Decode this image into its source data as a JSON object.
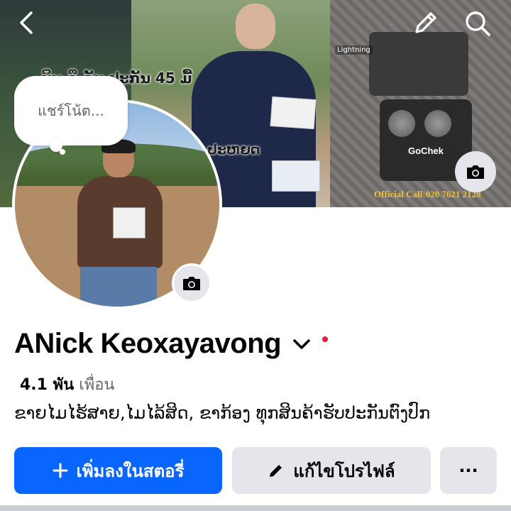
{
  "cover": {
    "text_promo": "ບິນ ລຶ ລັບ ປະກັນ 45 ມື້",
    "text_promo2": "ປະຫຍດ",
    "label_lightning": "Lightning",
    "label_brand": "GoChek",
    "official_call": "Official Call:020 7621 2128"
  },
  "note": {
    "placeholder": "แชร์โน้ต..."
  },
  "profile": {
    "name": "ANick Keoxayavong",
    "friends_count": "4.1 พัน",
    "friends_label": "เพื่อน",
    "bio": "ຂາຍໄມໄຮ້ສາຍ,ໄມໄລ້ສິດ, ຂາກ້ອງ ທຸກສິນຄ້າຮັບປະກັນຕົງປົກ"
  },
  "actions": {
    "add_story": "เพิ่มลงในสตอรี่",
    "edit_profile": "แก้ไขโปรไฟล์",
    "more": "···"
  },
  "colors": {
    "primary": "#0866ff",
    "secondary_btn": "#e4e6eb",
    "notification_dot": "#e41e3f"
  },
  "icons": [
    "back-icon",
    "edit-pencil-icon",
    "search-icon",
    "camera-icon",
    "chevron-down-icon",
    "plus-icon",
    "pencil-icon"
  ]
}
